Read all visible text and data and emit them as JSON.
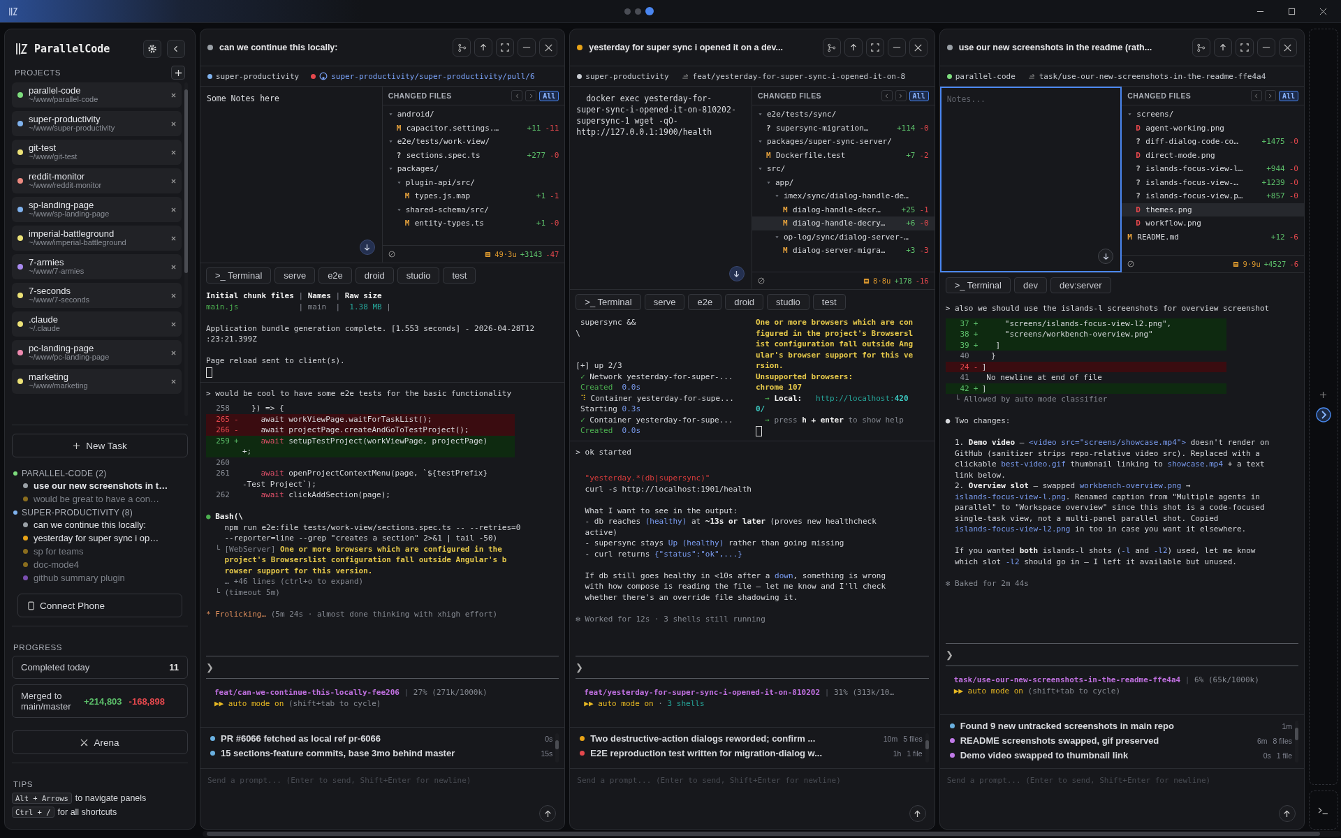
{
  "titlebar": {
    "pages": [
      {
        "selected": false
      },
      {
        "selected": false
      },
      {
        "selected": true
      }
    ]
  },
  "sidebar": {
    "title": "ParallelCode",
    "projects_label": "PROJECTS",
    "projects": [
      {
        "name": "parallel-code",
        "path": "~/www/parallel-code",
        "color": "#7ddc7d"
      },
      {
        "name": "super-productivity",
        "path": "~/www/super-productivity",
        "color": "#7fb2ee"
      },
      {
        "name": "git-test",
        "path": "~/www/git-test",
        "color": "#ece277"
      },
      {
        "name": "reddit-monitor",
        "path": "~/www/reddit-monitor",
        "color": "#ec8a80"
      },
      {
        "name": "sp-landing-page",
        "path": "~/www/sp-landing-page",
        "color": "#7fb2ee"
      },
      {
        "name": "imperial-battleground",
        "path": "~/www/imperial-battleground",
        "color": "#ece277"
      },
      {
        "name": "7-armies",
        "path": "~/www/7-armies",
        "color": "#a98af0"
      },
      {
        "name": "7-seconds",
        "path": "~/www/7-seconds",
        "color": "#ece277"
      },
      {
        "name": ".claude",
        "path": "~/.claude",
        "color": "#ece277"
      },
      {
        "name": "pc-landing-page",
        "path": "~/www/pc-landing-page",
        "color": "#ef8ab0"
      },
      {
        "name": "marketing",
        "path": "~/www/marketing",
        "color": "#ece277"
      }
    ],
    "new_task": "New Task",
    "task_groups": [
      {
        "name": "PARALLEL-CODE (2)",
        "color": "#7ddc7d",
        "tasks": [
          {
            "text": "use our new screenshots in t…",
            "color": "#9aa0a6",
            "open": true,
            "selected": true
          },
          {
            "text": "would be great to have a con…",
            "color": "#8a6d1e",
            "open": false,
            "selected": false
          }
        ]
      },
      {
        "name": "SUPER-PRODUCTIVITY (8)",
        "color": "#7fb2ee",
        "tasks": [
          {
            "text": "can we continue this locally:",
            "color": "#9aa0a6",
            "open": true,
            "selected": false
          },
          {
            "text": "yesterday for super sync i op…",
            "color": "#e8a317",
            "open": true,
            "selected": false
          },
          {
            "text": "sp for teams",
            "color": "#8a6d1e",
            "open": false,
            "selected": false
          },
          {
            "text": "doc-mode4",
            "color": "#8a6d1e",
            "open": false,
            "selected": false
          },
          {
            "text": "github summary plugin",
            "color": "#7a4fb0",
            "open": false,
            "selected": false
          }
        ]
      }
    ],
    "connect_phone": "Connect Phone",
    "progress_label": "PROGRESS",
    "completed_label": "Completed today",
    "completed_value": "11",
    "merged_label": "Merged to main/master",
    "merged_added": "+214,803",
    "merged_removed": "-168,898",
    "arena": "Arena",
    "tips_label": "TIPS",
    "tips": [
      {
        "keys": "Alt + Arrows",
        "text": "to navigate panels"
      },
      {
        "keys": "Ctrl + /",
        "text": "for all shortcuts"
      }
    ]
  },
  "panels": [
    {
      "title": "can we continue this locally:",
      "color": "#9aa0a6",
      "project": {
        "name": "super-productivity",
        "color": "#7fb2ee"
      },
      "link": {
        "kind": "pr",
        "text": "super-productivity/super-productivity/pull/6",
        "color": "#e5484d"
      },
      "notes": {
        "value": "Some Notes here",
        "focused": false
      },
      "changed_files": {
        "label": "CHANGED FILES",
        "all_label": "All",
        "all_selected": true,
        "summary": "49·3u",
        "added": "+3143",
        "removed": "-47",
        "items": [
          {
            "kind": "dir",
            "name": "android/",
            "expanded": true,
            "children": [
              {
                "kind": "file",
                "status": "M",
                "name": "capacitor.settings.…",
                "added": "+11",
                "removed": "-11",
                "selected": false
              }
            ]
          },
          {
            "kind": "dir",
            "name": "e2e/tests/work-view/",
            "expanded": true,
            "children": [
              {
                "kind": "file",
                "status": "?",
                "name": "sections.spec.ts",
                "added": "+277",
                "removed": "-0",
                "selected": false
              }
            ]
          },
          {
            "kind": "dir",
            "name": "packages/",
            "expanded": true,
            "children": [
              {
                "kind": "dir",
                "name": "plugin-api/src/",
                "expanded": true,
                "children": [
                  {
                    "kind": "file",
                    "status": "M",
                    "name": "types.js.map",
                    "added": "+1",
                    "removed": "-1",
                    "selected": false
                  }
                ]
              },
              {
                "kind": "dir",
                "name": "shared-schema/src/",
                "expanded": true,
                "children": [
                  {
                    "kind": "file",
                    "status": "M",
                    "name": "entity-types.ts",
                    "added": "+1",
                    "removed": "-0",
                    "selected": false
                  }
                ]
              }
            ]
          }
        ]
      },
      "terminal_tabs": [
        ">_ Terminal",
        "serve",
        "e2e",
        "droid",
        "studio",
        "test"
      ],
      "terminal": {
        "columns": [
          [
            {
              "kind": "text",
              "parts": [
                {
                  "text": "Initial chunk files",
                  "kind": "emphasis"
                },
                {
                  "text": " | ",
                  "kind": "muted"
                },
                {
                  "text": "Names",
                  "kind": "emphasis"
                },
                {
                  "text": " | ",
                  "kind": "muted"
                },
                {
                  "text": "Raw size",
                  "kind": "emphasis"
                }
              ]
            },
            {
              "kind": "text",
              "parts": [
                {
                  "text": "main.js",
                  "kind": "success"
                },
                {
                  "text": "             | main  |",
                  "kind": "muted"
                },
                {
                  "text": "  1.38 MB",
                  "kind": "url"
                },
                {
                  "text": " |",
                  "kind": "muted"
                }
              ]
            },
            {
              "kind": "blank"
            },
            {
              "kind": "text",
              "parts": [
                {
                  "text": "Application bundle generation complete. [1.553 seconds] - 2026-04-28T12"
                }
              ]
            },
            {
              "kind": "text",
              "parts": [
                {
                  "text": ":23:21.399Z"
                }
              ]
            },
            {
              "kind": "blank"
            },
            {
              "kind": "text",
              "parts": [
                {
                  "text": "Page reload sent to client(s)."
                }
              ]
            },
            {
              "kind": "cursor"
            }
          ]
        ]
      },
      "chat": [
        {
          "kind": "prompt",
          "parts": [
            {
              "text": "> would be cool to have some e2e tests for the basic functionality"
            }
          ]
        },
        {
          "kind": "ctx",
          "num": "258",
          "parts": [
            {
              "text": "  }) => {"
            }
          ]
        },
        {
          "kind": "del",
          "num": "265",
          "sign": "-",
          "parts": [
            {
              "text": "    await workViewPage.waitForTaskList();"
            }
          ]
        },
        {
          "kind": "del",
          "num": "266",
          "sign": "-",
          "parts": [
            {
              "text": "    await projectPage.createAndGoToTestProject();"
            }
          ]
        },
        {
          "kind": "add",
          "num": "259",
          "sign": "+",
          "parts": [
            {
              "text": "    await",
              "kind": "keyword"
            },
            {
              "text": " setupTestProject(workViewPage, projectPage)"
            }
          ]
        },
        {
          "kind": "add",
          "parts": [
            {
              "text": "+;"
            }
          ]
        },
        {
          "kind": "ctx",
          "num": "260"
        },
        {
          "kind": "ctx",
          "num": "261",
          "parts": [
            {
              "text": "    await",
              "kind": "keyword"
            },
            {
              "text": " openProjectContextMenu(page, `${testPrefix}"
            }
          ]
        },
        {
          "kind": "ctx",
          "parts": [
            {
              "text": "-Test Project`);"
            }
          ]
        },
        {
          "kind": "ctx",
          "num": "262",
          "parts": [
            {
              "text": "    await",
              "kind": "keyword"
            },
            {
              "text": " clickAddSection(page);"
            }
          ]
        },
        {
          "kind": "blank"
        },
        {
          "kind": "text",
          "parts": [
            {
              "text": "● ",
              "kind": "success"
            },
            {
              "text": "Bash(\\",
              "kind": "emphasis"
            }
          ]
        },
        {
          "kind": "text",
          "parts": [
            {
              "text": "    npm run e2e:file tests/work-view/sections.spec.ts -- --retries=0"
            }
          ]
        },
        {
          "kind": "text",
          "parts": [
            {
              "text": "    --reporter=line --grep \"creates a section\" 2>&1 | tail -50)"
            }
          ]
        },
        {
          "kind": "text",
          "parts": [
            {
              "text": "  └ [WebServer] ",
              "kind": "muted"
            },
            {
              "text": "One or more browsers which are configured in the",
              "kind": "warning"
            }
          ]
        },
        {
          "kind": "text",
          "parts": [
            {
              "text": "    project's Browserslist configuration fall outside Angular's b",
              "kind": "warning"
            }
          ]
        },
        {
          "kind": "text",
          "parts": [
            {
              "text": "    rowser support for this version.",
              "kind": "warning"
            }
          ]
        },
        {
          "kind": "text",
          "parts": [
            {
              "text": "    … +46 lines (ctrl+o to expand)",
              "kind": "muted"
            }
          ]
        },
        {
          "kind": "text",
          "parts": [
            {
              "text": "  └ (timeout 5m)",
              "kind": "muted"
            }
          ]
        },
        {
          "kind": "blank"
        },
        {
          "kind": "text",
          "parts": [
            {
              "text": "* Frolicking…",
              "kind": "spinner"
            },
            {
              "text": " (5m 24s · almost done thinking with xhigh effort)",
              "kind": "muted"
            }
          ]
        }
      ],
      "prompt_symbol": "❯",
      "status_line": [
        {
          "text": "feat/can-we-continue-this-locally-fee206",
          "kind": "branch"
        },
        {
          "text": " | ",
          "kind": "separator"
        },
        {
          "text": "27% (271k/1000k)",
          "kind": "muted"
        }
      ],
      "mode": [
        {
          "text": "▶▶ auto mode on",
          "kind": "mode"
        },
        {
          "text": " (shift+tab to cycle)",
          "kind": "muted"
        }
      ],
      "tasks": [
        {
          "text": "PR #6066 fetched as local ref pr-6066",
          "color": "#6ab0e0",
          "time": "0s"
        },
        {
          "text": "15 sections-feature commits, base 3mo behind master",
          "color": "#6ab0e0",
          "time": "15s"
        }
      ],
      "prompt_placeholder": "Send a prompt... (Enter to send, Shift+Enter for newline)"
    },
    {
      "title": "yesterday for super sync i opened it on a dev...",
      "color": "#e8a317",
      "project": {
        "name": "super-productivity",
        "color": "#c8ccd2"
      },
      "link": {
        "kind": "branch",
        "text": "feat/yesterday-for-super-sync-i-opened-it-on-8"
      },
      "notes": {
        "value": "  docker exec yesterday-for-\nsuper-sync-i-opened-it-on-810202-\nsupersync-1 wget -qO-\nhttp://127.0.0.1:1900/health",
        "focused": false
      },
      "changed_files": {
        "label": "CHANGED FILES",
        "all_label": "All",
        "all_selected": true,
        "summary": "8·8u",
        "added": "+178",
        "removed": "-16",
        "items": [
          {
            "kind": "dir",
            "name": "e2e/tests/sync/",
            "expanded": true,
            "children": [
              {
                "kind": "file",
                "status": "?",
                "name": "supersync-migration…",
                "added": "+114",
                "removed": "-0",
                "selected": false
              }
            ]
          },
          {
            "kind": "dir",
            "name": "packages/super-sync-server/",
            "expanded": true,
            "children": [
              {
                "kind": "file",
                "status": "M",
                "name": "Dockerfile.test",
                "added": "+7",
                "removed": "-2",
                "selected": false
              }
            ]
          },
          {
            "kind": "dir",
            "name": "src/",
            "expanded": true,
            "children": [
              {
                "kind": "dir",
                "name": "app/",
                "expanded": true,
                "children": [
                  {
                    "kind": "dir",
                    "name": "imex/sync/dialog-handle-de…",
                    "expanded": true,
                    "children": [
                      {
                        "kind": "file",
                        "status": "M",
                        "name": "dialog-handle-decr…",
                        "added": "+25",
                        "removed": "-1",
                        "selected": false
                      },
                      {
                        "kind": "file",
                        "status": "M",
                        "name": "dialog-handle-decry…",
                        "added": "+6",
                        "removed": "-0",
                        "selected": true
                      }
                    ]
                  },
                  {
                    "kind": "dir",
                    "name": "op-log/sync/dialog-server-…",
                    "expanded": true,
                    "children": [
                      {
                        "kind": "file",
                        "status": "M",
                        "name": "dialog-server-migra…",
                        "added": "+3",
                        "removed": "-3",
                        "selected": false
                      }
                    ]
                  }
                ]
              }
            ]
          }
        ]
      },
      "terminal_tabs": [
        ">_ Terminal",
        "serve",
        "e2e",
        "droid",
        "studio",
        "test"
      ],
      "terminal": {
        "columns": [
          [
            {
              "kind": "text",
              "parts": [
                {
                  "text": " supersync &&"
                }
              ]
            },
            {
              "kind": "text",
              "parts": [
                {
                  "text": "\\"
                }
              ]
            },
            {
              "kind": "blank"
            },
            {
              "kind": "blank"
            },
            {
              "kind": "text",
              "parts": [
                {
                  "text": "[+] up 2/3"
                }
              ]
            },
            {
              "kind": "text",
              "parts": [
                {
                  "text": " ✓",
                  "kind": "success"
                },
                {
                  "text": " Network yesterday-for-super-..."
                }
              ]
            },
            {
              "kind": "text",
              "parts": [
                {
                  "text": " Created",
                  "kind": "success"
                },
                {
                  "text": "  0.0s",
                  "kind": "code"
                }
              ]
            },
            {
              "kind": "text",
              "parts": [
                {
                  "text": " ⠹",
                  "kind": "mode"
                },
                {
                  "text": " Container yesterday-for-supe..."
                }
              ]
            },
            {
              "kind": "text",
              "parts": [
                {
                  "text": " Starting "
                },
                {
                  "text": "0.3s",
                  "kind": "code"
                }
              ]
            },
            {
              "kind": "text",
              "parts": [
                {
                  "text": " ✓",
                  "kind": "success"
                },
                {
                  "text": " Container yesterday-for-supe..."
                }
              ]
            },
            {
              "kind": "text",
              "parts": [
                {
                  "text": " Created",
                  "kind": "success"
                },
                {
                  "text": "  0.0s",
                  "kind": "code"
                }
              ]
            }
          ],
          [
            {
              "kind": "text",
              "parts": [
                {
                  "text": "One or more browsers which are con",
                  "kind": "warning"
                }
              ]
            },
            {
              "kind": "text",
              "parts": [
                {
                  "text": "figured in the project's Browsersl",
                  "kind": "warning"
                }
              ]
            },
            {
              "kind": "text",
              "parts": [
                {
                  "text": "ist configuration fall outside Ang",
                  "kind": "warning"
                }
              ]
            },
            {
              "kind": "text",
              "parts": [
                {
                  "text": "ular's browser support for this ve",
                  "kind": "warning"
                }
              ]
            },
            {
              "kind": "text",
              "parts": [
                {
                  "text": "rsion.",
                  "kind": "warning"
                }
              ]
            },
            {
              "kind": "text",
              "parts": [
                {
                  "text": "Unsupported browsers:",
                  "kind": "warning"
                }
              ]
            },
            {
              "kind": "text",
              "parts": [
                {
                  "text": "chrome 107",
                  "kind": "warning"
                }
              ]
            },
            {
              "kind": "text",
              "parts": [
                {
                  "text": "  → ",
                  "kind": "success"
                },
                {
                  "text": "Local:",
                  "kind": "emphasis"
                },
                {
                  "text": "   http://localhost:",
                  "kind": "url"
                },
                {
                  "text": "420",
                  "kind": "port"
                }
              ]
            },
            {
              "kind": "text",
              "parts": [
                {
                  "text": "0/",
                  "kind": "port"
                }
              ]
            },
            {
              "kind": "text",
              "parts": [
                {
                  "text": "  → ",
                  "kind": "success"
                },
                {
                  "text": "press ",
                  "kind": "muted"
                },
                {
                  "text": "h + enter",
                  "kind": "emphasis"
                },
                {
                  "text": " to show help",
                  "kind": "muted"
                }
              ]
            },
            {
              "kind": "cursor"
            }
          ]
        ]
      },
      "chat": [
        {
          "kind": "prompt",
          "parts": [
            {
              "text": "> ok started"
            }
          ]
        },
        {
          "kind": "blank"
        },
        {
          "kind": "text",
          "parts": [
            {
              "text": "  \"yesterday.*(db|supersync)\"",
              "kind": "pattern"
            }
          ]
        },
        {
          "kind": "text",
          "parts": [
            {
              "text": "  curl -s http://localhost:1901/health"
            }
          ]
        },
        {
          "kind": "blank"
        },
        {
          "kind": "text",
          "parts": [
            {
              "text": "  What I want to see in the output:"
            }
          ]
        },
        {
          "kind": "text",
          "parts": [
            {
              "text": "  - db reaches "
            },
            {
              "text": "(healthy)",
              "kind": "code"
            },
            {
              "text": " at "
            },
            {
              "text": "~13s or later",
              "kind": "emphasis"
            },
            {
              "text": " (proves new healthcheck"
            }
          ]
        },
        {
          "kind": "text",
          "parts": [
            {
              "text": "  active)"
            }
          ]
        },
        {
          "kind": "text",
          "parts": [
            {
              "text": "  - supersync stays "
            },
            {
              "text": "Up (healthy)",
              "kind": "code"
            },
            {
              "text": " rather than going missing"
            }
          ]
        },
        {
          "kind": "text",
          "parts": [
            {
              "text": "  - curl returns "
            },
            {
              "text": "{\"status\":\"ok\",...}",
              "kind": "code"
            }
          ]
        },
        {
          "kind": "blank"
        },
        {
          "kind": "text",
          "parts": [
            {
              "text": "  If db still goes healthy in <10s after a "
            },
            {
              "text": "down",
              "kind": "code"
            },
            {
              "text": ", something is wrong"
            }
          ]
        },
        {
          "kind": "text",
          "parts": [
            {
              "text": "  with how compose is reading the file — let me know and I'll check"
            }
          ]
        },
        {
          "kind": "text",
          "parts": [
            {
              "text": "  whether there's an override file shadowing it."
            }
          ]
        },
        {
          "kind": "blank"
        },
        {
          "kind": "text",
          "parts": [
            {
              "text": "✻ Worked for 12s · 3 shells still running",
              "kind": "muted"
            }
          ]
        }
      ],
      "prompt_symbol": "❯",
      "status_line": [
        {
          "text": "feat/yesterday-for-super-sync-i-opened-it-on-810202",
          "kind": "branch"
        },
        {
          "text": " | ",
          "kind": "separator"
        },
        {
          "text": "31% (313k/10…",
          "kind": "muted"
        }
      ],
      "mode": [
        {
          "text": "▶▶ auto mode on",
          "kind": "mode"
        },
        {
          "text": " · ",
          "kind": "muted"
        },
        {
          "text": "3 shells",
          "kind": "url"
        }
      ],
      "tasks": [
        {
          "text": "Two destructive-action dialogs reworded; confirm ...",
          "color": "#e8a317",
          "time": "10m",
          "files": "5 files"
        },
        {
          "text": "E2E reproduction test written for migration-dialog w...",
          "color": "#e5484d",
          "time": "1h",
          "files": "1 file"
        }
      ],
      "prompt_placeholder": "Send a prompt... (Enter to send, Shift+Enter for newline)"
    },
    {
      "title": "use our new screenshots in the readme (rath...",
      "color": "#9aa0a6",
      "project": {
        "name": "parallel-code",
        "color": "#7ddc7d"
      },
      "link": {
        "kind": "branch",
        "text": "task/use-our-new-screenshots-in-the-readme-ffe4a4"
      },
      "notes": {
        "placeholder": "Notes...",
        "focused": true
      },
      "changed_files": {
        "label": "CHANGED FILES",
        "all_label": "All",
        "all_selected": true,
        "summary": "9·9u",
        "added": "+4527",
        "removed": "-6",
        "items": [
          {
            "kind": "dir",
            "name": "screens/",
            "expanded": true,
            "children": [
              {
                "kind": "file",
                "status": "D",
                "name": "agent-working.png",
                "selected": false
              },
              {
                "kind": "file",
                "status": "?",
                "name": "diff-dialog-code-co…",
                "added": "+1475",
                "removed": "-0",
                "selected": false
              },
              {
                "kind": "file",
                "status": "D",
                "name": "direct-mode.png",
                "selected": false
              },
              {
                "kind": "file",
                "status": "?",
                "name": "islands-focus-view-l…",
                "added": "+944",
                "removed": "-0",
                "selected": false
              },
              {
                "kind": "file",
                "status": "?",
                "name": "islands-focus-view-…",
                "added": "+1239",
                "removed": "-0",
                "selected": false
              },
              {
                "kind": "file",
                "status": "?",
                "name": "islands-focus-view.p…",
                "added": "+857",
                "removed": "-0",
                "selected": false
              },
              {
                "kind": "file",
                "status": "D",
                "name": "themes.png",
                "selected": true
              },
              {
                "kind": "file",
                "status": "D",
                "name": "workflow.png",
                "selected": false
              }
            ]
          },
          {
            "kind": "file",
            "status": "M",
            "name": "README.md",
            "added": "+12",
            "removed": "-6",
            "selected": false
          }
        ]
      },
      "terminal_tabs": [
        ">_ Terminal",
        "dev",
        "dev:server"
      ],
      "chat": [
        {
          "kind": "prompt",
          "parts": [
            {
              "text": "> also we should use the islands-l screenshots for overview screenshot"
            }
          ]
        },
        {
          "kind": "add",
          "num": "37",
          "sign": "+",
          "parts": [
            {
              "text": "     \"screens/islands-focus-view-l2.png\","
            }
          ]
        },
        {
          "kind": "add",
          "num": "38",
          "sign": "+",
          "parts": [
            {
              "text": "     \"screens/workbench-overview.png\""
            }
          ]
        },
        {
          "kind": "add",
          "num": "39",
          "sign": "+",
          "parts": [
            {
              "text": "   ]"
            }
          ]
        },
        {
          "kind": "ctx",
          "num": "40",
          "parts": [
            {
              "text": "  }"
            }
          ]
        },
        {
          "kind": "del",
          "num": "24",
          "sign": "-",
          "parts": [
            {
              "text": "]"
            }
          ]
        },
        {
          "kind": "ctx",
          "num": "41",
          "parts": [
            {
              "text": " No newline at end of file"
            }
          ]
        },
        {
          "kind": "add",
          "num": "42",
          "sign": "+",
          "parts": [
            {
              "text": "]"
            }
          ]
        },
        {
          "kind": "text",
          "parts": [
            {
              "text": "  └ Allowed by auto mode classifier",
              "kind": "muted"
            }
          ]
        },
        {
          "kind": "blank"
        },
        {
          "kind": "text",
          "parts": [
            {
              "text": "● Two changes:"
            }
          ]
        },
        {
          "kind": "blank"
        },
        {
          "kind": "text",
          "parts": [
            {
              "text": "  1. "
            },
            {
              "text": "Demo video",
              "kind": "emphasis"
            },
            {
              "text": " — "
            },
            {
              "text": "<video src=\"screens/showcase.mp4\">",
              "kind": "code"
            },
            {
              "text": " doesn't render on"
            }
          ]
        },
        {
          "kind": "text",
          "parts": [
            {
              "text": "  GitHub (sanitizer strips repo-relative video src). Replaced with a"
            }
          ]
        },
        {
          "kind": "text",
          "parts": [
            {
              "text": "  clickable "
            },
            {
              "text": "best-video.gif",
              "kind": "code"
            },
            {
              "text": " thumbnail linking to "
            },
            {
              "text": "showcase.mp4",
              "kind": "code"
            },
            {
              "text": " + a text"
            }
          ]
        },
        {
          "kind": "text",
          "parts": [
            {
              "text": "  link below."
            }
          ]
        },
        {
          "kind": "text",
          "parts": [
            {
              "text": "  2. "
            },
            {
              "text": "Overview slot",
              "kind": "emphasis"
            },
            {
              "text": " — swapped "
            },
            {
              "text": "workbench-overview.png",
              "kind": "code"
            },
            {
              "text": " →"
            }
          ]
        },
        {
          "kind": "text",
          "parts": [
            {
              "text": "  islands-focus-view-l.png",
              "kind": "code"
            },
            {
              "text": ". Renamed caption from \"Multiple agents in"
            }
          ]
        },
        {
          "kind": "text",
          "parts": [
            {
              "text": "  parallel\" to \"Workspace overview\" since this shot is a code-focused"
            }
          ]
        },
        {
          "kind": "text",
          "parts": [
            {
              "text": "  single-task view, not a multi-panel parallel shot. Copied"
            }
          ]
        },
        {
          "kind": "text",
          "parts": [
            {
              "text": "  islands-focus-view-l2.png",
              "kind": "code"
            },
            {
              "text": " in too in case you want it elsewhere."
            }
          ]
        },
        {
          "kind": "blank"
        },
        {
          "kind": "text",
          "parts": [
            {
              "text": "  If you wanted "
            },
            {
              "text": "both",
              "kind": "emphasis"
            },
            {
              "text": " islands-l shots ("
            },
            {
              "text": "-l",
              "kind": "code"
            },
            {
              "text": " and "
            },
            {
              "text": "-l2",
              "kind": "code"
            },
            {
              "text": ") used, let me know"
            }
          ]
        },
        {
          "kind": "text",
          "parts": [
            {
              "text": "  which slot "
            },
            {
              "text": "-l2",
              "kind": "code"
            },
            {
              "text": " should go in — I left it available but unused."
            }
          ]
        },
        {
          "kind": "blank"
        },
        {
          "kind": "text",
          "parts": [
            {
              "text": "✻ Baked for 2m 44s",
              "kind": "muted"
            }
          ]
        }
      ],
      "prompt_symbol": "❯",
      "status_line": [
        {
          "text": "task/use-our-new-screenshots-in-the-readme-ffe4a4",
          "kind": "branch"
        },
        {
          "text": " | ",
          "kind": "separator"
        },
        {
          "text": "6% (65k/1000k)",
          "kind": "muted"
        }
      ],
      "mode": [
        {
          "text": "▶▶ auto mode on",
          "kind": "mode"
        },
        {
          "text": " (shift+tab to cycle)",
          "kind": "muted"
        }
      ],
      "tasks": [
        {
          "text": "Found 9 new untracked screenshots in main repo",
          "color": "#6ab0e0",
          "time": "1m"
        },
        {
          "text": "README screenshots swapped, gif preserved",
          "color": "#c07ae8",
          "time": "6m",
          "files": "8 files"
        },
        {
          "text": "Demo video swapped to thumbnail link",
          "color": "#c07ae8",
          "time": "0s",
          "files": "1 file"
        }
      ],
      "prompt_placeholder": "Send a prompt... (Enter to send, Shift+Enter for newline)"
    }
  ]
}
